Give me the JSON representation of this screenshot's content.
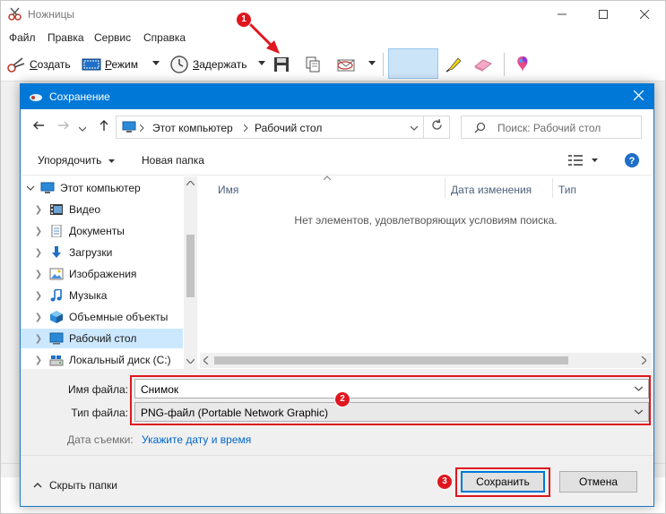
{
  "app": {
    "title": "Ножницы",
    "menu": [
      "Файл",
      "Правка",
      "Сервис",
      "Справка"
    ],
    "toolbar": {
      "create_prefix": "С",
      "create_rest": "оздать",
      "mode_prefix": "Р",
      "mode_rest": "ежим",
      "delay_prefix": "З",
      "delay_rest": "адержать"
    }
  },
  "dialog": {
    "title": "Сохранение",
    "address": {
      "crumbs": [
        "Этот компьютер",
        "Рабочий стол"
      ]
    },
    "search_placeholder": "Поиск: Рабочий стол",
    "commands": {
      "organize": "Упорядочить",
      "new_folder": "Новая папка"
    },
    "nav_items": [
      {
        "label": "Этот компьютер",
        "icon": "computer-icon"
      },
      {
        "label": "Видео",
        "icon": "video-icon"
      },
      {
        "label": "Документы",
        "icon": "documents-icon"
      },
      {
        "label": "Загрузки",
        "icon": "download-icon"
      },
      {
        "label": "Изображения",
        "icon": "pictures-icon"
      },
      {
        "label": "Музыка",
        "icon": "music-icon"
      },
      {
        "label": "Объемные объекты",
        "icon": "3d-objects-icon"
      },
      {
        "label": "Рабочий стол",
        "icon": "desktop-icon"
      },
      {
        "label": "Локальный диск (C:)",
        "icon": "drive-icon"
      }
    ],
    "columns": [
      "Имя",
      "Дата изменения",
      "Тип"
    ],
    "empty_message": "Нет элементов, удовлетворяющих условиям поиска.",
    "form": {
      "filename_label": "Имя файла:",
      "filename_value": "Снимок",
      "filetype_label": "Тип файла:",
      "filetype_value": "PNG-файл (Portable Network Graphic)",
      "date_label": "Дата съемки:",
      "date_link": "Укажите дату и время"
    },
    "footer": {
      "hide_folders": "Скрыть папки",
      "save": "Сохранить",
      "cancel": "Отмена"
    }
  },
  "annotations": [
    "1",
    "2",
    "3"
  ],
  "colors": {
    "accent": "#0078d7",
    "annotation": "#e0161e",
    "link": "#0066cc",
    "selection": "#cce8ff"
  }
}
